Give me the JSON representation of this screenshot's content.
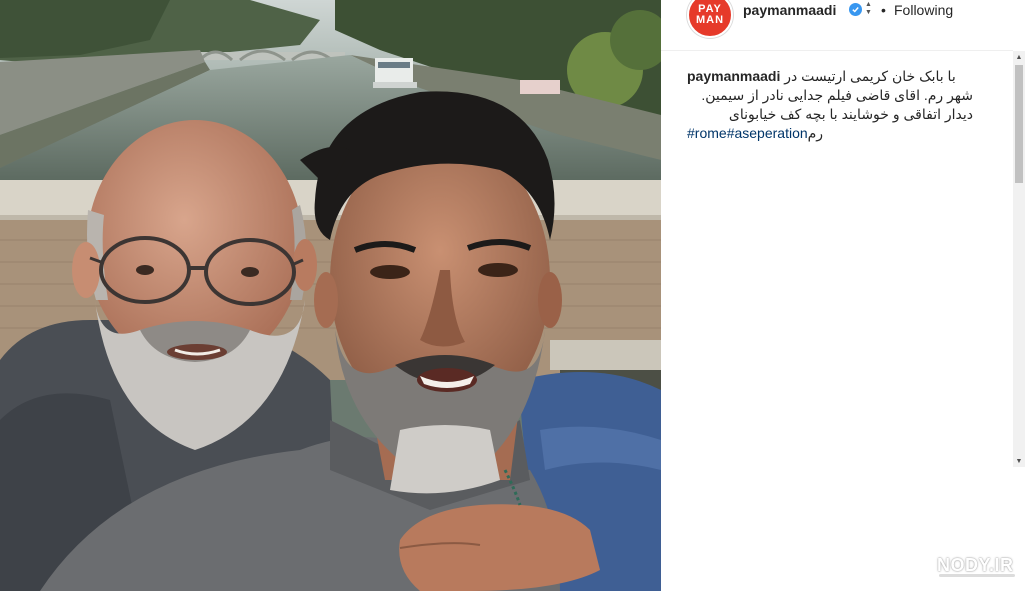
{
  "header": {
    "username": "paymanmaadi",
    "avatar_text_top": "PAY",
    "avatar_text_bottom": "MAN",
    "separator": "•",
    "follow_label": "Following"
  },
  "caption": {
    "username": "paymanmaadi",
    "line1": "با بابک خان کریمی ارتیست در",
    "line2": "شهر رم. اقای قاضی فیلم جدایی نادر از سیمین.",
    "line3": "دیدار اتفاقی و خوشایند با بچه کف خیابونای",
    "hashtag1": "#rome",
    "hashtag2": "#aseperation",
    "line4_tail": "رم"
  },
  "watermark": {
    "text": "NODY.IR"
  },
  "icons": {
    "avatar": "profile-avatar",
    "verified": "verified-badge-icon",
    "scroll_up": "scroll-up-arrow-icon",
    "scroll_down": "scroll-down-arrow-icon"
  },
  "colors": {
    "verified": "#3897f0",
    "avatar": "#e63a2a",
    "hashtag": "#003569",
    "text": "#262626"
  }
}
